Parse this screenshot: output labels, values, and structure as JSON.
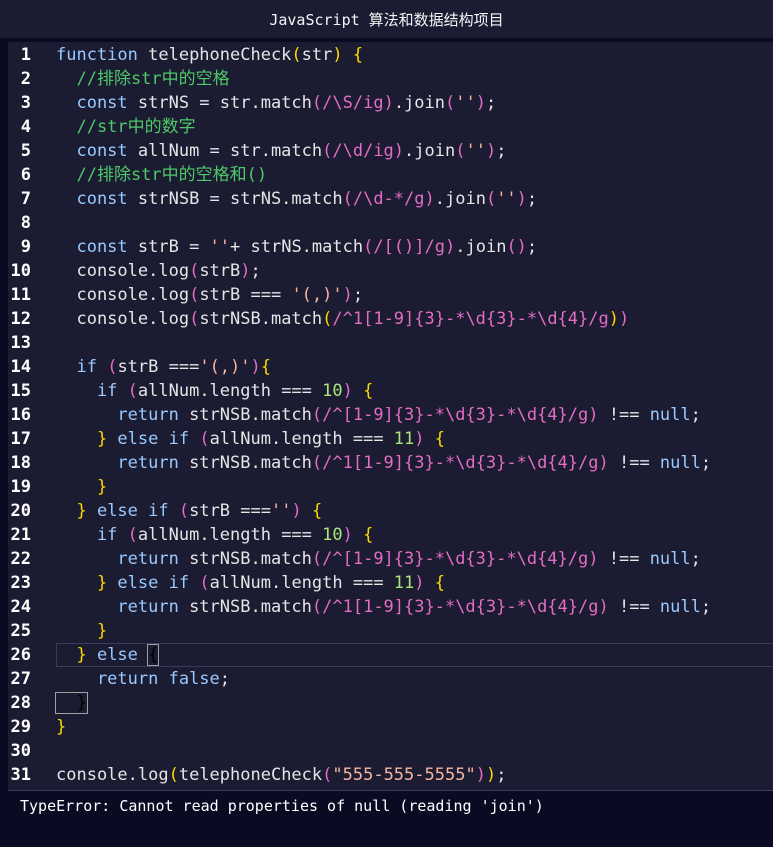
{
  "window": {
    "title": "JavaScript 算法和数据结构项目"
  },
  "editor": {
    "language": "javascript",
    "active_line": 26,
    "lines": [
      {
        "n": "1",
        "t": [
          [
            "kw",
            "function "
          ],
          [
            "fn",
            "telephoneCheck"
          ],
          [
            "br",
            "("
          ],
          [
            "pl",
            "str"
          ],
          [
            "br",
            ")"
          ],
          [
            "pl",
            " "
          ],
          [
            "br",
            "{"
          ]
        ]
      },
      {
        "n": "2",
        "t": [
          [
            "cm",
            "  //排除str中的空格"
          ]
        ]
      },
      {
        "n": "3",
        "t": [
          [
            "kw",
            "  const "
          ],
          [
            "pl",
            "strNS = str.match"
          ],
          [
            "br2",
            "("
          ],
          [
            "rx",
            "/\\S/ig"
          ],
          [
            "br2",
            ")"
          ],
          [
            "pl",
            ".join"
          ],
          [
            "br2",
            "("
          ],
          [
            "str",
            "''"
          ],
          [
            "br2",
            ")"
          ],
          [
            "pl",
            ";"
          ]
        ]
      },
      {
        "n": "4",
        "t": [
          [
            "cm",
            "  //str中的数字"
          ]
        ]
      },
      {
        "n": "5",
        "t": [
          [
            "kw",
            "  const "
          ],
          [
            "pl",
            "allNum = str.match"
          ],
          [
            "br2",
            "("
          ],
          [
            "rx",
            "/\\d/ig"
          ],
          [
            "br2",
            ")"
          ],
          [
            "pl",
            ".join"
          ],
          [
            "br2",
            "("
          ],
          [
            "str",
            "''"
          ],
          [
            "br2",
            ")"
          ],
          [
            "pl",
            ";"
          ]
        ]
      },
      {
        "n": "6",
        "t": [
          [
            "cm",
            "  //排除str中的空格和()"
          ]
        ]
      },
      {
        "n": "7",
        "t": [
          [
            "kw",
            "  const "
          ],
          [
            "pl",
            "strNSB = strNS.match"
          ],
          [
            "br2",
            "("
          ],
          [
            "rx",
            "/\\d-*/g"
          ],
          [
            "br2",
            ")"
          ],
          [
            "pl",
            ".join"
          ],
          [
            "br2",
            "("
          ],
          [
            "str",
            "''"
          ],
          [
            "br2",
            ")"
          ],
          [
            "pl",
            ";"
          ]
        ]
      },
      {
        "n": "8",
        "t": []
      },
      {
        "n": "9",
        "t": [
          [
            "kw",
            "  const "
          ],
          [
            "pl",
            "strB = "
          ],
          [
            "str",
            "''"
          ],
          [
            "pl",
            "+ strNS.match"
          ],
          [
            "br2",
            "("
          ],
          [
            "rx",
            "/[()]/g"
          ],
          [
            "br2",
            ")"
          ],
          [
            "pl",
            ".join"
          ],
          [
            "br2",
            "()"
          ],
          [
            "pl",
            ";"
          ]
        ]
      },
      {
        "n": "10",
        "t": [
          [
            "pl",
            "  console.log"
          ],
          [
            "br2",
            "("
          ],
          [
            "pl",
            "strB"
          ],
          [
            "br2",
            ")"
          ],
          [
            "pl",
            ";"
          ]
        ]
      },
      {
        "n": "11",
        "t": [
          [
            "pl",
            "  console.log"
          ],
          [
            "br2",
            "("
          ],
          [
            "pl",
            "strB === "
          ],
          [
            "str",
            "'(,)'"
          ],
          [
            "br2",
            ")"
          ],
          [
            "pl",
            ";"
          ]
        ]
      },
      {
        "n": "12",
        "t": [
          [
            "pl",
            "  console.log"
          ],
          [
            "br2",
            "("
          ],
          [
            "pl",
            "strNSB.match"
          ],
          [
            "br",
            "("
          ],
          [
            "rx",
            "/^1[1-9]{3}-*\\d{3}-*\\d{4}/g"
          ],
          [
            "br",
            ")"
          ],
          [
            "br2",
            ")"
          ]
        ]
      },
      {
        "n": "13",
        "t": []
      },
      {
        "n": "14",
        "t": [
          [
            "kw",
            "  if "
          ],
          [
            "br2",
            "("
          ],
          [
            "pl",
            "strB ==="
          ],
          [
            "str",
            "'(,)'"
          ],
          [
            "br2",
            ")"
          ],
          [
            "br",
            "{"
          ]
        ]
      },
      {
        "n": "15",
        "t": [
          [
            "kw",
            "    if "
          ],
          [
            "br2",
            "("
          ],
          [
            "pl",
            "allNum.length === "
          ],
          [
            "num",
            "10"
          ],
          [
            "br2",
            ")"
          ],
          [
            "pl",
            " "
          ],
          [
            "br",
            "{"
          ]
        ]
      },
      {
        "n": "16",
        "t": [
          [
            "kw",
            "      return "
          ],
          [
            "pl",
            "strNSB.match"
          ],
          [
            "br2",
            "("
          ],
          [
            "rx",
            "/^[1-9]{3}-*\\d{3}-*\\d{4}/g"
          ],
          [
            "br2",
            ")"
          ],
          [
            "pl",
            " !== "
          ],
          [
            "lit",
            "null"
          ],
          [
            "pl",
            ";"
          ]
        ]
      },
      {
        "n": "17",
        "t": [
          [
            "br",
            "    }"
          ],
          [
            "kw",
            " else if "
          ],
          [
            "br2",
            "("
          ],
          [
            "pl",
            "allNum.length === "
          ],
          [
            "num",
            "11"
          ],
          [
            "br2",
            ")"
          ],
          [
            "pl",
            " "
          ],
          [
            "br",
            "{"
          ]
        ]
      },
      {
        "n": "18",
        "t": [
          [
            "kw",
            "      return "
          ],
          [
            "pl",
            "strNSB.match"
          ],
          [
            "br2",
            "("
          ],
          [
            "rx",
            "/^1[1-9]{3}-*\\d{3}-*\\d{4}/g"
          ],
          [
            "br2",
            ")"
          ],
          [
            "pl",
            " !== "
          ],
          [
            "lit",
            "null"
          ],
          [
            "pl",
            ";"
          ]
        ]
      },
      {
        "n": "19",
        "t": [
          [
            "br",
            "    }"
          ]
        ]
      },
      {
        "n": "20",
        "t": [
          [
            "br",
            "  }"
          ],
          [
            "kw",
            " else if "
          ],
          [
            "br2",
            "("
          ],
          [
            "pl",
            "strB ==="
          ],
          [
            "str",
            "''"
          ],
          [
            "br2",
            ")"
          ],
          [
            "pl",
            " "
          ],
          [
            "br",
            "{"
          ]
        ]
      },
      {
        "n": "21",
        "t": [
          [
            "kw",
            "    if "
          ],
          [
            "br2",
            "("
          ],
          [
            "pl",
            "allNum.length === "
          ],
          [
            "num",
            "10"
          ],
          [
            "br2",
            ")"
          ],
          [
            "pl",
            " "
          ],
          [
            "br",
            "{"
          ]
        ]
      },
      {
        "n": "22",
        "t": [
          [
            "kw",
            "      return "
          ],
          [
            "pl",
            "strNSB.match"
          ],
          [
            "br2",
            "("
          ],
          [
            "rx",
            "/^[1-9]{3}-*\\d{3}-*\\d{4}/g"
          ],
          [
            "br2",
            ")"
          ],
          [
            "pl",
            " !== "
          ],
          [
            "lit",
            "null"
          ],
          [
            "pl",
            ";"
          ]
        ]
      },
      {
        "n": "23",
        "t": [
          [
            "br",
            "    }"
          ],
          [
            "kw",
            " else if "
          ],
          [
            "br2",
            "("
          ],
          [
            "pl",
            "allNum.length === "
          ],
          [
            "num",
            "11"
          ],
          [
            "br2",
            ")"
          ],
          [
            "pl",
            " "
          ],
          [
            "br",
            "{"
          ]
        ]
      },
      {
        "n": "24",
        "t": [
          [
            "kw",
            "      return "
          ],
          [
            "pl",
            "strNSB.match"
          ],
          [
            "br2",
            "("
          ],
          [
            "rx",
            "/^1[1-9]{3}-*\\d{3}-*\\d{4}/g"
          ],
          [
            "br2",
            ")"
          ],
          [
            "pl",
            " !== "
          ],
          [
            "lit",
            "null"
          ],
          [
            "pl",
            ";"
          ]
        ]
      },
      {
        "n": "25",
        "t": [
          [
            "br",
            "    }"
          ]
        ]
      },
      {
        "n": "26",
        "t": [
          [
            "br",
            "  }"
          ],
          [
            "kw",
            " else "
          ],
          [
            "bx",
            "{"
          ]
        ]
      },
      {
        "n": "27",
        "t": [
          [
            "kw",
            "    return "
          ],
          [
            "lit",
            "false"
          ],
          [
            "pl",
            ";"
          ]
        ]
      },
      {
        "n": "28",
        "t": [
          [
            "bx",
            "  }"
          ]
        ]
      },
      {
        "n": "29",
        "t": [
          [
            "br",
            "}"
          ]
        ]
      },
      {
        "n": "30",
        "t": []
      },
      {
        "n": "31",
        "t": [
          [
            "pl",
            "console.log"
          ],
          [
            "br",
            "("
          ],
          [
            "pl",
            "telephoneCheck"
          ],
          [
            "br2",
            "("
          ],
          [
            "str",
            "\"555-555-5555\""
          ],
          [
            "br2",
            ")"
          ],
          [
            "br",
            ")"
          ],
          [
            "pl",
            ";"
          ]
        ]
      }
    ]
  },
  "console": {
    "output": "TypeError: Cannot read properties of null (reading 'join')"
  }
}
